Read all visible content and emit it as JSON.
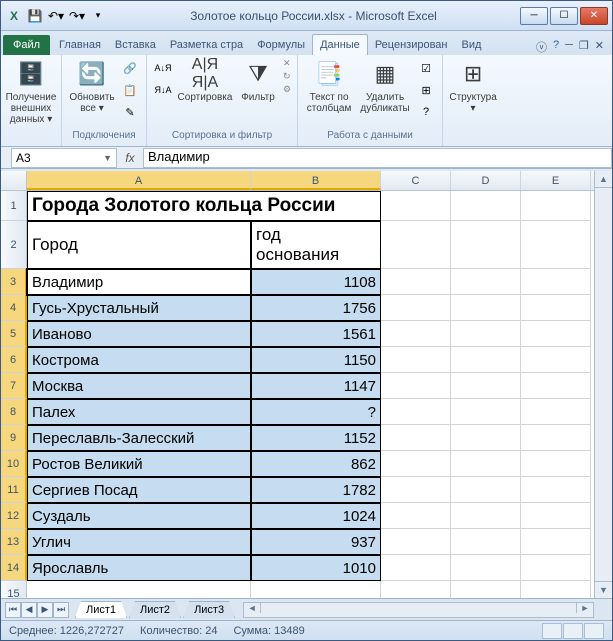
{
  "window": {
    "title": "Золотое кольцо России.xlsx - Microsoft Excel"
  },
  "tabs": {
    "file": "Файл",
    "items": [
      "Главная",
      "Вставка",
      "Разметка стра",
      "Формулы",
      "Данные",
      "Рецензирован",
      "Вид"
    ],
    "active_index": 4
  },
  "ribbon": {
    "groups": [
      {
        "caption": "",
        "buttons": [
          {
            "label": "Получение\nвнешних данных ▾",
            "glyph": "⇩"
          }
        ]
      },
      {
        "caption": "Подключения",
        "buttons": [
          {
            "label": "Обновить\nвсе ▾",
            "glyph": "↻"
          }
        ],
        "small": [
          "Подключения",
          "Свойства",
          "Изменить связи"
        ]
      },
      {
        "caption": "Сортировка и фильтр",
        "buttons": [
          {
            "label": "",
            "glyph": "A↓"
          },
          {
            "label": "",
            "glyph": "Z↓"
          },
          {
            "label": "Сортировка",
            "glyph": "⇅"
          },
          {
            "label": "Фильтр",
            "glyph": "▼"
          }
        ]
      },
      {
        "caption": "Работа с данными",
        "buttons": [
          {
            "label": "Текст по\nстолбцам",
            "glyph": "≡"
          },
          {
            "label": "Удалить\nдубликаты",
            "glyph": "▦"
          }
        ]
      },
      {
        "caption": "",
        "buttons": [
          {
            "label": "Структура\n▾",
            "glyph": "⊞"
          }
        ]
      }
    ]
  },
  "namebox": "A3",
  "formula": "Владимир",
  "sheet": {
    "title": "Города Золотого кольца России",
    "header_city": "Город",
    "header_year": "год\nоснования",
    "rows": [
      {
        "city": "Владимир",
        "year": "1108"
      },
      {
        "city": "Гусь-Хрустальный",
        "year": "1756"
      },
      {
        "city": "Иваново",
        "year": "1561"
      },
      {
        "city": "Кострома",
        "year": "1150"
      },
      {
        "city": "Москва",
        "year": "1147"
      },
      {
        "city": "Палех",
        "year": "?"
      },
      {
        "city": "Переславль-Залесский",
        "year": "1152"
      },
      {
        "city": "Ростов Великий",
        "year": "862"
      },
      {
        "city": "Сергиев Посад",
        "year": "1782"
      },
      {
        "city": "Суздаль",
        "year": "1024"
      },
      {
        "city": "Углич",
        "year": "937"
      },
      {
        "city": "Ярославль",
        "year": "1010"
      }
    ]
  },
  "sheet_tabs": [
    "Лист1",
    "Лист2",
    "Лист3"
  ],
  "status": {
    "avg_label": "Среднее:",
    "avg": "1226,272727",
    "count_label": "Количество:",
    "count": "24",
    "sum_label": "Сумма:",
    "sum": "13489"
  }
}
